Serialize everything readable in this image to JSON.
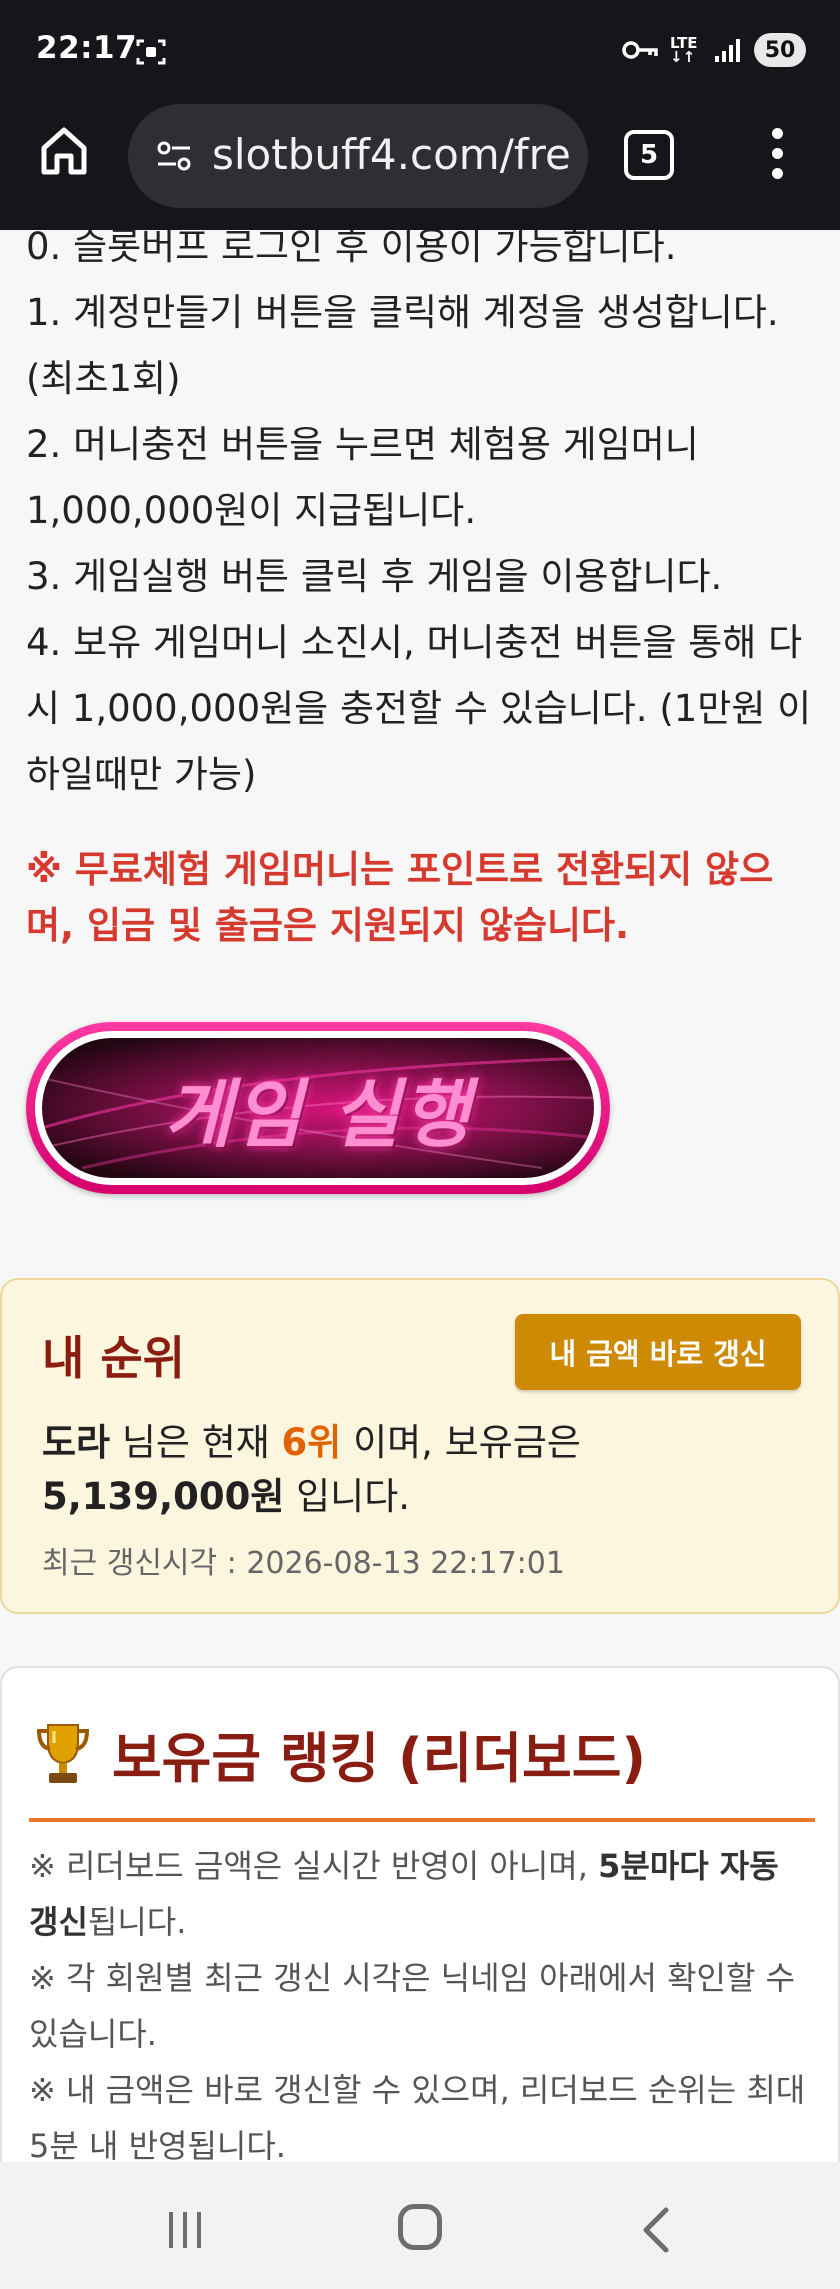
{
  "status_bar": {
    "time": "22:17",
    "network": "LTE",
    "battery": "50",
    "icons": [
      "screenshot-icon",
      "vpn-key-icon",
      "lte-icon",
      "signal-icon",
      "battery-icon"
    ]
  },
  "browser": {
    "url": "slotbuff4.com/fre",
    "tab_count": "5",
    "icons": [
      "home-icon",
      "tune-icon",
      "tabs-icon",
      "more-vert-icon"
    ]
  },
  "steps": [
    "0. 슬롯버프 로그인 후 이용이 가능합니다.",
    "1. 계정만들기 버튼을 클릭해 계정을 생성합니다.(최초1회)",
    "2. 머니충전 버튼을 누르면 체험용 게임머니 1,000,000원이 지급됩니다.",
    "3. 게임실행 버튼 클릭 후 게임을 이용합니다.",
    "4. 보유 게임머니 소진시, 머니충전 버튼을 통해 다시 1,000,000원을 충전할 수 있습니다. (1만원 이하일때만 가능)"
  ],
  "notice": "※ 무료체험 게임머니는 포인트로 전환되지 않으며, 입금 및 출금은 지원되지 않습니다.",
  "game_button": {
    "label": "게임 실행"
  },
  "my_rank": {
    "title": "내 순위",
    "refresh_label": "내 금액 바로 갱신",
    "nickname": "도라",
    "text_1": " 님은 현재 ",
    "rank": "6위",
    "text_2": " 이며, 보유금은",
    "amount": "5,139,000원",
    "text_3": " 입니다.",
    "updated_label": "최근 갱신시각 : ",
    "updated_time": "2026-08-13 22:17:01"
  },
  "leaderboard": {
    "title": "보유금 랭킹 (리더보드)",
    "note_1_a": "※ 리더보드 금액은 실시간 반영이 아니며, ",
    "note_1_b": "5분마다 자동 갱신",
    "note_1_c": "됩니다.",
    "note_2": "※ 각 회원별 최근 갱신 시각은 닉네임 아래에서 확인할 수 있습니다.",
    "note_3": "※ 내 금액은 바로 갱신할 수 있으며, 리더보드 순위는 최대 5분 내 반영됩니다."
  },
  "nav_bar": {
    "icons": [
      "recents-icon",
      "home-nav-icon",
      "back-icon"
    ]
  },
  "colors": {
    "status_bg": "#15161a",
    "notice_red": "#d63a2f",
    "rank_title": "#8a1d11",
    "refresh_btn": "#cf8a05",
    "rank_highlight": "#e06200",
    "leader_rule": "#e9782b",
    "game_btn_pink": "#e0007a"
  }
}
